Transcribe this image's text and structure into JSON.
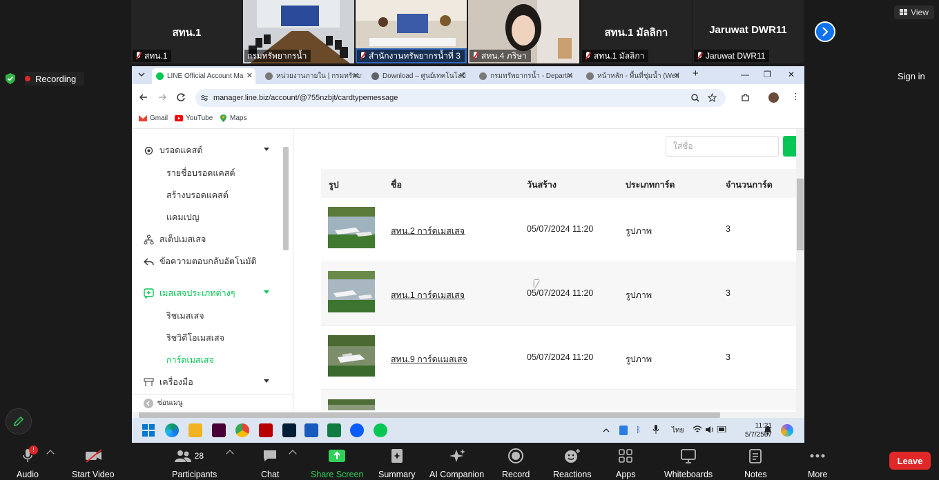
{
  "participants": [
    {
      "name": "สทน.1",
      "label": "สทน.1",
      "has_video": false
    },
    {
      "name": "",
      "label": "กรมทรัพยากรน้ำ",
      "has_video": true,
      "active": true
    },
    {
      "name": "",
      "label": "สำนักงานทรัพยากรน้ำที่ 3",
      "has_video": true
    },
    {
      "name": "",
      "label": "สทน.4 ภริษา",
      "has_video": true
    },
    {
      "name": "สทน.1 มัลลิกา",
      "label": "สทน.1 มัลลิกา",
      "has_video": false
    },
    {
      "name": "Jaruwat DWR11",
      "label": "Jaruwat DWR11",
      "has_video": false
    }
  ],
  "zoom": {
    "view_label": "View",
    "recording_label": "Recording",
    "sign_in_label": "Sign in",
    "leave_label": "Leave",
    "audio_badge": "!",
    "participants_count": "28",
    "toolbar": [
      {
        "label": "Audio",
        "icon": "microphone-icon"
      },
      {
        "label": "Start Video",
        "icon": "video-off-icon"
      },
      {
        "label": "Participants",
        "icon": "participants-icon"
      },
      {
        "label": "Chat",
        "icon": "chat-icon"
      },
      {
        "label": "Share Screen",
        "icon": "share-screen-icon"
      },
      {
        "label": "Summary",
        "icon": "summary-icon"
      },
      {
        "label": "AI Companion",
        "icon": "ai-companion-icon"
      },
      {
        "label": "Record",
        "icon": "record-icon"
      },
      {
        "label": "Reactions",
        "icon": "reactions-icon"
      },
      {
        "label": "Apps",
        "icon": "apps-icon"
      },
      {
        "label": "Whiteboards",
        "icon": "whiteboard-icon"
      },
      {
        "label": "Notes",
        "icon": "notes-icon"
      },
      {
        "label": "More",
        "icon": "more-icon"
      }
    ]
  },
  "browser": {
    "tabs": [
      {
        "title": "LINE Official Account Ma",
        "active": true,
        "color": "#06c755"
      },
      {
        "title": "หน่วยงานภายใน | กรมทรัพยา",
        "active": false,
        "color": "#7a7a7a"
      },
      {
        "title": "Download – ศูนย์เทคโนโลยี",
        "active": false,
        "color": "#5f6368"
      },
      {
        "title": "กรมทรัพยากรน้ำ - Departm",
        "active": false,
        "color": "#7a7a7a"
      },
      {
        "title": "หน้าหลัก - พื้นที่ชุ่มน้ำ (Wetl",
        "active": false,
        "color": "#7a7a7a"
      }
    ],
    "url": "manager.line.biz/account/@755nzbjt/cardtypemessage",
    "bookmarks": [
      {
        "label": "Gmail",
        "icon": "gmail-icon"
      },
      {
        "label": "YouTube",
        "icon": "youtube-icon"
      },
      {
        "label": "Maps",
        "icon": "maps-icon"
      }
    ]
  },
  "sidebar": {
    "broadcast": "บรอดแคสต์",
    "broadcast_list": "รายชื่อบรอดแคสต์",
    "create_broadcast": "สร้างบรอดแคสต์",
    "campaign": "แคมเปญ",
    "step_message": "สเต็ปเมสเสจ",
    "auto_reply": "ข้อความตอบกลับอัตโนมัติ",
    "message_types": "เมสเสจประเภทต่างๆ",
    "rich_message": "ริชเมสเสจ",
    "rich_video_message": "ริชวิดีโอเมสเสจ",
    "card_message": "การ์ดเมสเสจ",
    "tools": "เครื่องมือ",
    "hide_menu": "ซ่อนเมนู"
  },
  "search": {
    "placeholder": "ใส่ชื่อ"
  },
  "table": {
    "headers": [
      "รูป",
      "ชื่อ",
      "วันสร้าง",
      "ประเภทการ์ด",
      "จำนวนการ์ด"
    ],
    "rows": [
      {
        "name": "สทน.2 การ์ดเมสเสจ",
        "created": "05/07/2024 11:20",
        "type": "รูปภาพ",
        "count": "3"
      },
      {
        "name": "สทน.1 การ์ดเมสเสจ",
        "created": "05/07/2024 11:20",
        "type": "รูปภาพ",
        "count": "3"
      },
      {
        "name": "สทน.9 การ์ดแมสเสจ",
        "created": "05/07/2024 11:20",
        "type": "รูปภาพ",
        "count": "3"
      }
    ]
  },
  "taskbar": {
    "time": "11:21",
    "date": "5/7/2567",
    "lang": "ไทย"
  }
}
